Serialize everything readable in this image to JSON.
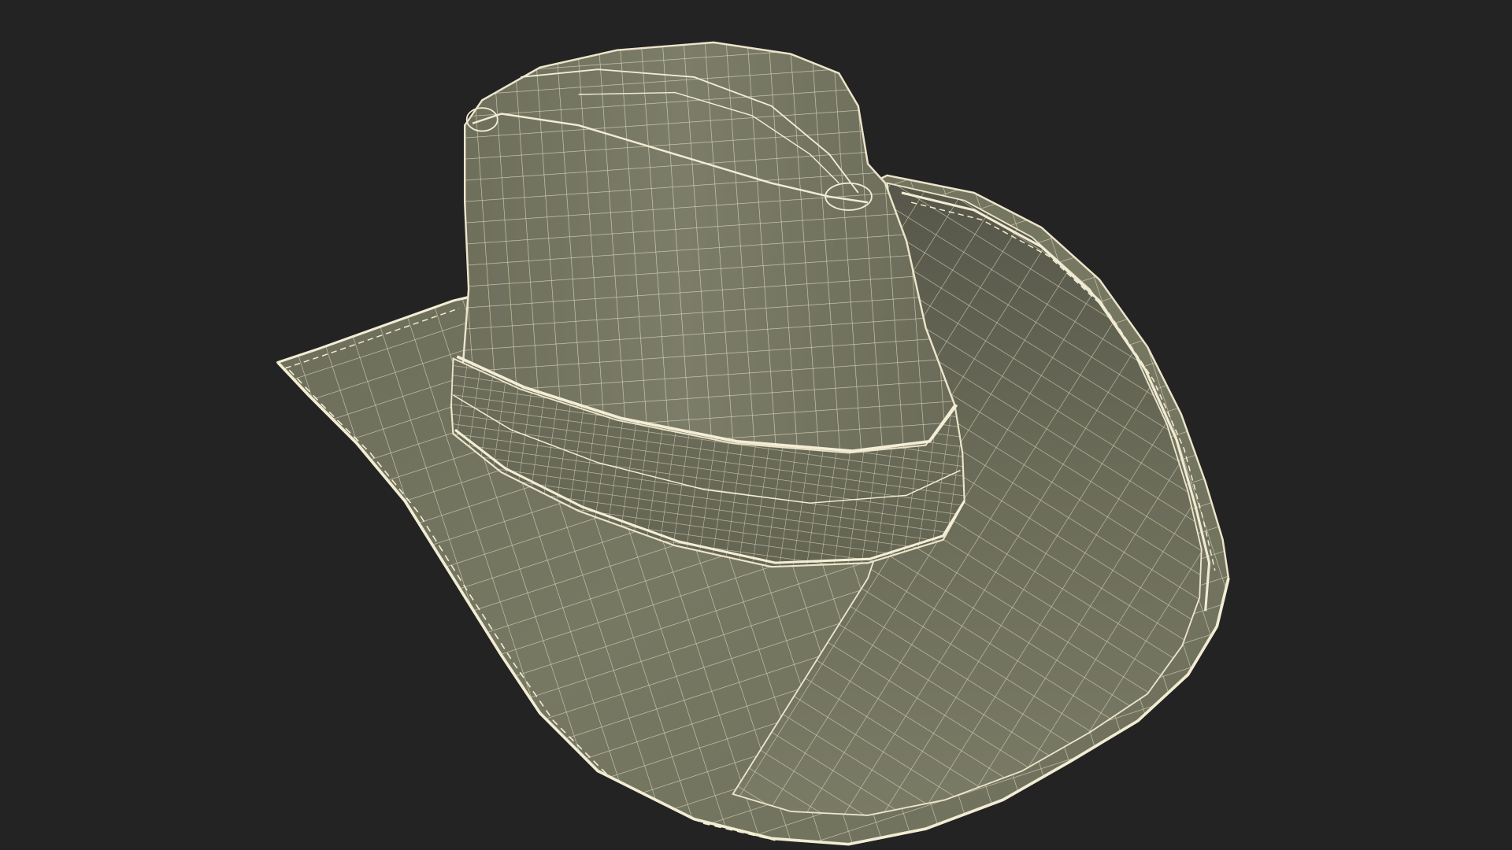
{
  "scene": {
    "subject": "hat-wireframe-render",
    "render_mode": "wireframe-on-shaded",
    "colors": {
      "background": "#232323",
      "surface": "#74755f",
      "surface_dark": "#5d5e4c",
      "surface_light": "#838571",
      "wire": "#f0ead2"
    }
  }
}
